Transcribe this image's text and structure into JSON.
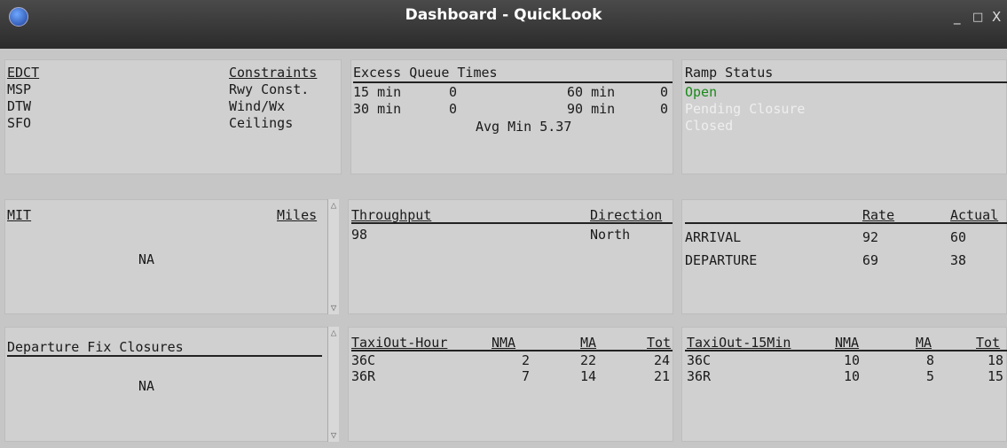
{
  "window": {
    "title": "Dashboard - QuickLook",
    "minimize": "_",
    "maximize": "□",
    "close": "X"
  },
  "edct": {
    "header": "EDCT",
    "constraints_header": "Constraints",
    "rows": [
      {
        "airport": "MSP",
        "constraint": "Rwy Const."
      },
      {
        "airport": "DTW",
        "constraint": "Wind/Wx"
      },
      {
        "airport": "SFO",
        "constraint": "Ceilings"
      }
    ]
  },
  "excess_queue": {
    "header": "Excess Queue Times",
    "r1": {
      "l1": "15 min",
      "v1": "0",
      "l2": "60 min",
      "v2": "0"
    },
    "r2": {
      "l1": "30 min",
      "v1": "0",
      "l2": "90 min",
      "v2": "0"
    },
    "avg": "Avg Min 5.37"
  },
  "ramp": {
    "header": "Ramp Status",
    "open": "Open",
    "pending": "Pending Closure",
    "closed": "Closed",
    "colors": {
      "open": "#1a8a1a",
      "inactive": "#eeeeee"
    }
  },
  "mit": {
    "header": "MIT",
    "miles_header": "Miles",
    "value": "NA"
  },
  "throughput": {
    "header": "Throughput",
    "direction_header": "Direction",
    "value": "98",
    "direction": "North"
  },
  "rates": {
    "rate_header": "Rate",
    "actual_header": "Actual",
    "rows": [
      {
        "label": "ARRIVAL",
        "rate": "92",
        "actual": "60"
      },
      {
        "label": "DEPARTURE",
        "rate": "69",
        "actual": "38"
      }
    ]
  },
  "fix": {
    "header": "Departure Fix Closures",
    "value": "NA"
  },
  "taxi_hour": {
    "header": "TaxiOut-Hour",
    "nma": "NMA",
    "ma": "MA",
    "tot": "Tot",
    "rows": [
      {
        "rwy": "36C",
        "nma": "2",
        "ma": "22",
        "tot": "24"
      },
      {
        "rwy": "36R",
        "nma": "7",
        "ma": "14",
        "tot": "21"
      }
    ]
  },
  "taxi_15": {
    "header": "TaxiOut-15Min",
    "nma": "NMA",
    "ma": "MA",
    "tot": "Tot",
    "rows": [
      {
        "rwy": "36C",
        "nma": "10",
        "ma": "8",
        "tot": "18"
      },
      {
        "rwy": "36R",
        "nma": "10",
        "ma": "5",
        "tot": "15"
      }
    ]
  },
  "scroll": {
    "up": "△",
    "down": "▽"
  }
}
